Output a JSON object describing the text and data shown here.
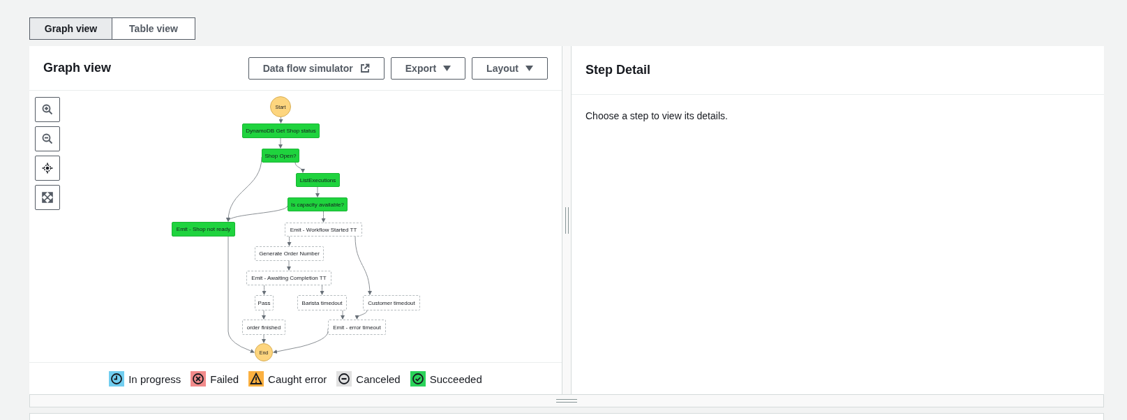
{
  "view_tabs": [
    {
      "label": "Graph view",
      "selected": true
    },
    {
      "label": "Table view",
      "selected": false
    }
  ],
  "graph_panel": {
    "title": "Graph view",
    "buttons": [
      {
        "label": "Data flow simulator",
        "kind": "external"
      },
      {
        "label": "Export",
        "kind": "dropdown"
      },
      {
        "label": "Layout",
        "kind": "dropdown"
      }
    ],
    "states": [
      {
        "label": "Start",
        "kind": "terminal"
      },
      {
        "label": "DynamoDB Get Shop status",
        "kind": "step",
        "succeeded": true
      },
      {
        "label": "Shop Open?",
        "kind": "step",
        "succeeded": true
      },
      {
        "label": "ListExecutions",
        "kind": "step",
        "succeeded": true
      },
      {
        "label": "Is capacity available?",
        "kind": "step",
        "succeeded": true
      },
      {
        "label": "Emit - Shop not ready",
        "kind": "step",
        "succeeded": true
      },
      {
        "label": "Emit - Workflow Started TT",
        "kind": "step",
        "succeeded": false
      },
      {
        "label": "Generate Order Number",
        "kind": "step",
        "succeeded": false
      },
      {
        "label": "Emit - Awaiting Completion TT",
        "kind": "step",
        "succeeded": false
      },
      {
        "label": "Pass",
        "kind": "step",
        "succeeded": false
      },
      {
        "label": "Barista timedout",
        "kind": "step",
        "succeeded": false
      },
      {
        "label": "Customer timedout",
        "kind": "step",
        "succeeded": false
      },
      {
        "label": "order finished",
        "kind": "step",
        "succeeded": false
      },
      {
        "label": "Emit - error timeout",
        "kind": "step",
        "succeeded": false
      },
      {
        "label": "End",
        "kind": "terminal"
      }
    ],
    "legend": [
      {
        "label": "In progress",
        "kind": "in_progress",
        "color": "#72cef0"
      },
      {
        "label": "Failed",
        "kind": "failed",
        "color": "#f28b8b"
      },
      {
        "label": "Caught error",
        "kind": "caught_error",
        "color": "#fbb040"
      },
      {
        "label": "Canceled",
        "kind": "canceled",
        "color": "#e1e1e1"
      },
      {
        "label": "Succeeded",
        "kind": "succeeded",
        "color": "#2bd35a"
      }
    ]
  },
  "step_detail": {
    "title": "Step Detail",
    "message": "Choose a step to view its details."
  }
}
